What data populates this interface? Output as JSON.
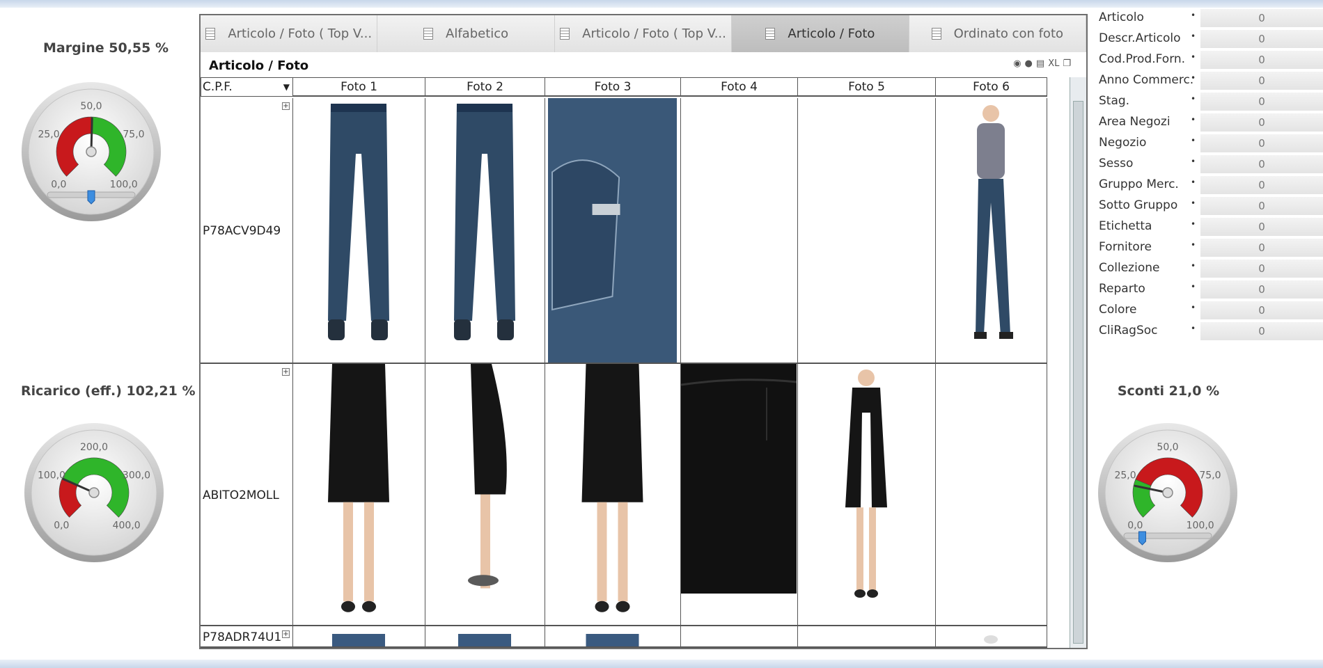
{
  "gauges": [
    {
      "id": "margine",
      "title": "Margine 50,55 %",
      "ticks": [
        "0,0",
        "25,0",
        "50,0",
        "75,0",
        "100,0"
      ],
      "value": 50.55,
      "min": 0,
      "max": 100,
      "slider": 0.5
    },
    {
      "id": "ricarico",
      "title": "Ricarico (eff.) 102,21 %",
      "ticks": [
        "0,0",
        "100,0",
        "200,0",
        "300,0",
        "400,0"
      ],
      "value": 102.21,
      "min": 0,
      "max": 400
    },
    {
      "id": "sconti",
      "title": "Sconti 21,0 %",
      "ticks": [
        "0,0",
        "25,0",
        "50,0",
        "75,0",
        "100,0"
      ],
      "value": 21.0,
      "min": 0,
      "max": 100,
      "slider": 0.21
    }
  ],
  "tabs": [
    {
      "label": "Articolo  / Foto  ( Top V...",
      "active": false
    },
    {
      "label": "Alfabetico",
      "active": false
    },
    {
      "label": "Articolo  / Foto  ( Top V...",
      "active": false
    },
    {
      "label": "Articolo  / Foto",
      "active": true
    },
    {
      "label": "Ordinato con foto",
      "active": false
    }
  ],
  "table": {
    "title": "Articolo  / Foto",
    "toolbar_text": "XL",
    "headers": [
      "C.P.F.",
      "Foto 1",
      "Foto 2",
      "Foto 3",
      "Foto 4",
      "Foto 5",
      "Foto 6"
    ],
    "rows": [
      {
        "code": "P78ACV9D49",
        "photos": [
          "jeans-front",
          "jeans-back",
          "jeans-pocket-detail",
          "",
          "",
          "model-tshirt-jeans"
        ]
      },
      {
        "code": "ABITO2MOLL",
        "photos": [
          "black-skirt-front",
          "black-skirt-side",
          "black-skirt-back",
          "black-fabric-detail",
          "model-black-dress",
          ""
        ]
      },
      {
        "code": "P78ADR74U1",
        "photos": [
          "jeans-partial",
          "jeans-partial",
          "jeans-partial",
          "",
          "",
          "shoe-partial"
        ]
      }
    ]
  },
  "listbox": [
    {
      "label": "Articolo",
      "value": "0"
    },
    {
      "label": "Descr.Articolo",
      "value": "0"
    },
    {
      "label": "Cod.Prod.Forn.",
      "value": "0"
    },
    {
      "label": "Anno Commerc.",
      "value": "0"
    },
    {
      "label": "Stag.",
      "value": "0"
    },
    {
      "label": "Area Negozi",
      "value": "0"
    },
    {
      "label": "Negozio",
      "value": "0"
    },
    {
      "label": "Sesso",
      "value": "0"
    },
    {
      "label": "Gruppo Merc.",
      "value": "0"
    },
    {
      "label": "Sotto Gruppo",
      "value": "0"
    },
    {
      "label": "Etichetta",
      "value": "0"
    },
    {
      "label": "Fornitore",
      "value": "0"
    },
    {
      "label": "Collezione",
      "value": "0"
    },
    {
      "label": "Reparto",
      "value": "0"
    },
    {
      "label": "Colore",
      "value": "0"
    },
    {
      "label": "CliRagSoc",
      "value": "0"
    }
  ],
  "colors": {
    "green": "#2fb52a",
    "red": "#c8191c",
    "denim": "#2f4a66",
    "black": "#151515"
  }
}
